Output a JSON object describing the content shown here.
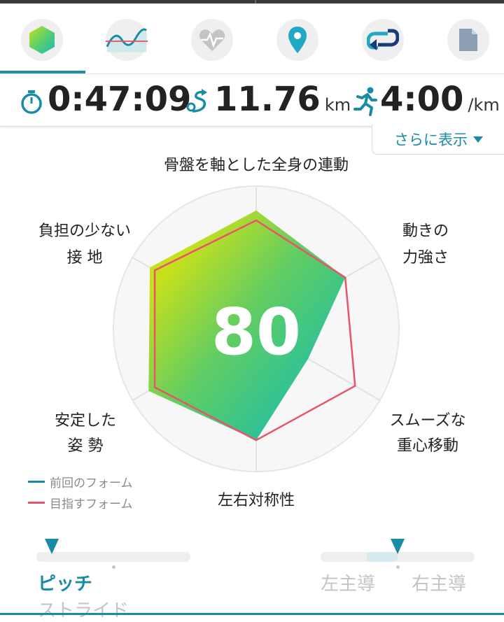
{
  "tabs": [
    {
      "name": "form-tab",
      "icon": "hexagon-icon"
    },
    {
      "name": "wave-tab",
      "icon": "wave-chart-icon"
    },
    {
      "name": "heart-tab",
      "icon": "heart-rate-icon"
    },
    {
      "name": "map-tab",
      "icon": "location-pin-icon"
    },
    {
      "name": "lap-tab",
      "icon": "loop-arrow-icon"
    },
    {
      "name": "report-tab",
      "icon": "document-icon"
    }
  ],
  "stats": {
    "time": "0:47:09",
    "distance": "11.76",
    "distance_unit": "km",
    "pace": "4:00",
    "pace_unit": "/km"
  },
  "more_label": "さらに表示",
  "radar": {
    "score": "80",
    "axes": {
      "top": "骨盤を軸とした全身の連動",
      "top_right_1": "動きの",
      "top_right_2": "力強さ",
      "bottom_right_1": "スムーズな",
      "bottom_right_2": "重心移動",
      "bottom": "左右対称性",
      "bottom_left_1": "安定した",
      "bottom_left_2": "姿 勢",
      "top_left_1": "負担の少ない",
      "top_left_2": "接 地"
    },
    "previous_scores": [
      0.83,
      0.72,
      0.42,
      0.78,
      0.87,
      0.86
    ],
    "target_scores": [
      0.76,
      0.72,
      0.8,
      0.78,
      0.82,
      0.82
    ]
  },
  "legend": {
    "previous": "前回のフォーム",
    "target": "目指すフォーム",
    "previous_color": "#1a8ba5",
    "target_color": "#e8546a"
  },
  "sliders": {
    "left": {
      "option_selected": "ピッチ",
      "option_other": "ストライド",
      "value": 0.1
    },
    "right": {
      "option_left": "左主導",
      "option_right": "右主導",
      "value": 0.5,
      "range": [
        0.3,
        0.5
      ]
    }
  }
}
